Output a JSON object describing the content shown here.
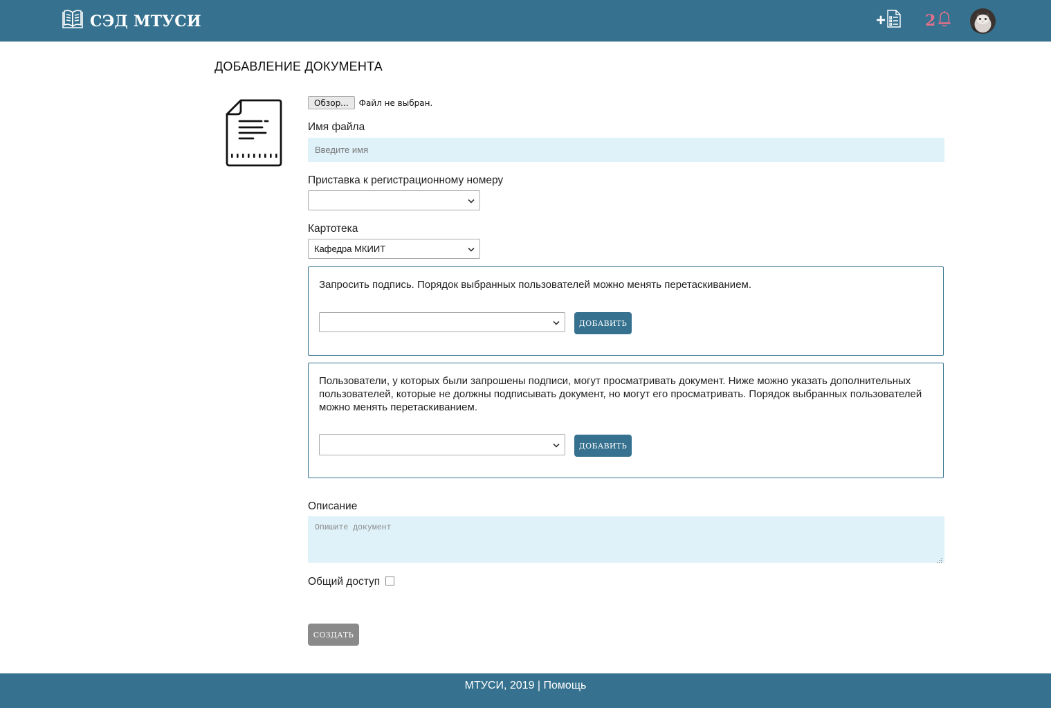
{
  "header": {
    "brand_title": "СЭД МТУСИ",
    "add_document_plus": "+",
    "notification_count": "2",
    "brand_color": "#36728f",
    "notification_color": "#e5708a",
    "icons": [
      "book-icon",
      "document-list-icon",
      "bell-icon",
      "avatar"
    ]
  },
  "page": {
    "title": "ДОБАВЛЕНИЕ ДОКУМЕНТА"
  },
  "form": {
    "file_browse_label": "Обзор...",
    "file_status": "Файл не выбран.",
    "filename_label": "Имя файла",
    "filename_placeholder": "Введите имя",
    "prefix_label": "Приставка к регистрационному номеру",
    "prefix_value": "",
    "card_index_label": "Картотека",
    "card_index_value": "Кафедра МКИИТ",
    "sign_panel": {
      "text": "Запросить подпись. Порядок выбранных пользователей можно менять перетаскиванием.",
      "select_value": "",
      "add_label": "ДОБАВИТЬ"
    },
    "viewers_panel": {
      "text": "Пользователи, у которых были запрошены подписи, могут просматривать документ. Ниже можно указать дополнительных пользователей, которые не должны подписывать документ, но могут его просматривать. Порядок выбранных пользователей можно менять перетаскиванием.",
      "select_value": "",
      "add_label": "ДОБАВИТЬ"
    },
    "description_label": "Описание",
    "description_placeholder": "Опишите документ",
    "shared_access_label": "Общий доступ",
    "shared_access_checked": false,
    "create_label": "СОЗДАТЬ"
  },
  "footer": {
    "copyright": "МТУСИ, 2019",
    "separator": "|",
    "help_link": "Помощь"
  }
}
